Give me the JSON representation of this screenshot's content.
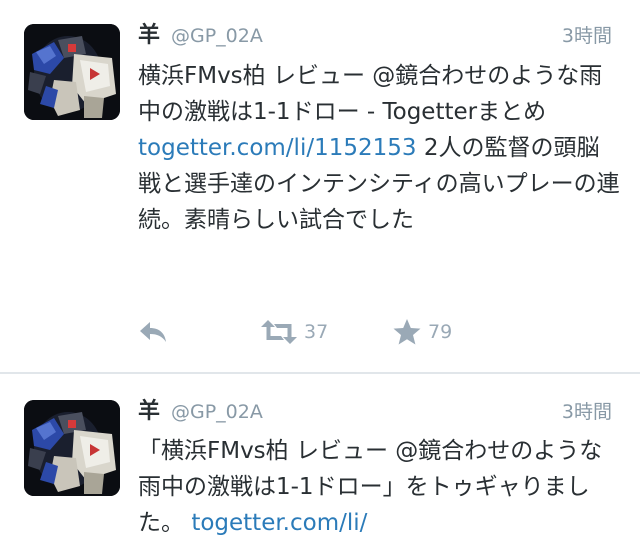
{
  "tweets": [
    {
      "name": "羊",
      "handle": "@GP_02A",
      "time": "3時間",
      "text_before": "横浜FMvs柏 レビュー @鏡合わせのような雨中の激戦は1-1ドロー - Togetterまとめ\n",
      "link": "togetter.com/li/1152153",
      "text_after": " 2人の監督の頭脳戦と選手達のインテンシティの高いプレーの連続。素晴らしい試合でした",
      "retweet_count": "37",
      "favorite_count": "79"
    },
    {
      "name": "羊",
      "handle": "@GP_02A",
      "time": "3時間",
      "text_before": "「横浜FMvs柏 レビュー @鏡合わせのような雨中の激戦は1-1ドロー」をトゥギャりました。 ",
      "link": "togetter.com/li/",
      "text_after": ""
    }
  ],
  "icons": {
    "avatar": "gundam-robot-avatar",
    "reply": "reply-arrow-icon",
    "retweet": "retweet-icon",
    "favorite": "star-icon"
  },
  "colors": {
    "name": "#292f33",
    "meta": "#8899a6",
    "link": "#2b7bb9",
    "action": "#9aa9b6"
  }
}
